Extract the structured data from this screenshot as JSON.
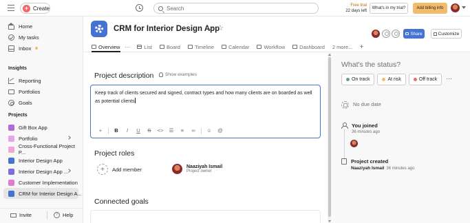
{
  "topbar": {
    "create_label": "Create",
    "search_placeholder": "Search",
    "trial_line1": "Free trial",
    "trial_line2": "22 days left",
    "whats_in_trial": "What's in my trial?",
    "add_billing": "Add billing info"
  },
  "sidebar": {
    "nav": [
      {
        "label": "Home",
        "icon": "home-icon"
      },
      {
        "label": "My tasks",
        "icon": "check-circle-icon"
      },
      {
        "label": "Inbox",
        "icon": "inbox-icon"
      }
    ],
    "insights_heading": "Insights",
    "insights": [
      {
        "label": "Reporting",
        "icon": "reporting-icon"
      },
      {
        "label": "Portfolios",
        "icon": "portfolio-icon"
      },
      {
        "label": "Goals",
        "icon": "goal-icon"
      }
    ],
    "projects_heading": "Projects",
    "projects": [
      {
        "label": "Gift Box App",
        "color": "#b36bd4"
      },
      {
        "label": "Portfolio",
        "color": "#e8a4e8"
      },
      {
        "label": "Cross-Functional Project P...",
        "color": "#f1a4d8"
      },
      {
        "label": "Interior Design App",
        "color": "#4573d2"
      },
      {
        "label": "Interior Design App ...",
        "color": "#7a6fe0"
      },
      {
        "label": "Customer Implementation",
        "color": "#e47ad8"
      },
      {
        "label": "CRM for Interior Design A...",
        "color": "#4573d2"
      }
    ],
    "invite_label": "Invite",
    "help_label": "Help"
  },
  "header": {
    "project_title": "CRM for Interior Design App",
    "tabs": [
      {
        "label": "Overview"
      },
      {
        "label": "List"
      },
      {
        "label": "Board"
      },
      {
        "label": "Timeline"
      },
      {
        "label": "Calendar"
      },
      {
        "label": "Workflow"
      },
      {
        "label": "Dashboard"
      },
      {
        "label": "2 more..."
      }
    ],
    "share_label": "Share",
    "customize_label": "Customize"
  },
  "main": {
    "description_heading": "Project description",
    "show_examples": "Show examples",
    "description_text": "Keep track of clients secured and signed, contract types and how many clients are on boarded as well as potential clients",
    "roles_heading": "Project roles",
    "add_member": "Add member",
    "member_name": "Naaziyah Ismail",
    "member_role": "Project owner",
    "goals_heading": "Connected goals"
  },
  "status_panel": {
    "heading": "What's the status?",
    "buttons": [
      {
        "label": "On track",
        "color": "#5da283"
      },
      {
        "label": "At risk",
        "color": "#f1bd6c"
      },
      {
        "label": "Off track",
        "color": "#f06a6a"
      }
    ],
    "no_due_date": "No due date",
    "joined_title": "You joined",
    "joined_time": "36 minutes ago",
    "created_title": "Project created",
    "created_by": "Naaziyah Ismail",
    "created_time": "36 minutes ago"
  }
}
